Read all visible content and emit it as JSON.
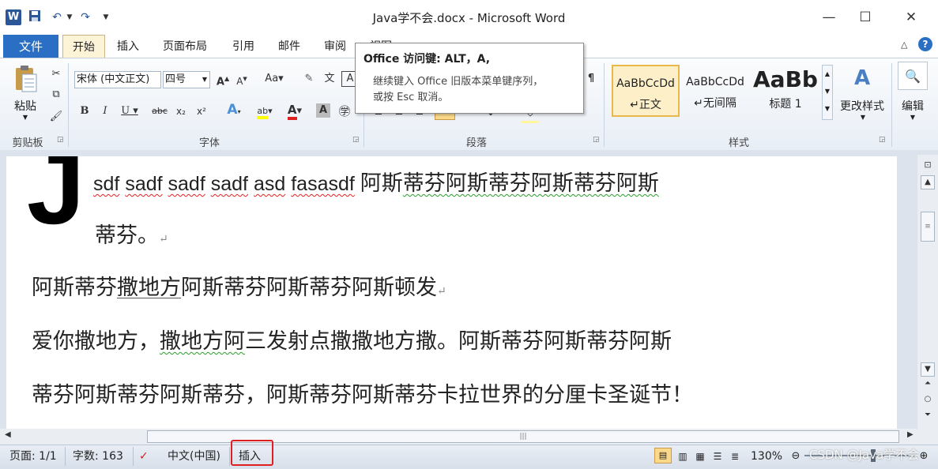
{
  "window": {
    "title": "Java学不会.docx - Microsoft Word",
    "app_icon": "W",
    "controls": {
      "minimize": "—",
      "maximize": "☐",
      "close": "✕"
    }
  },
  "tabs": [
    "文件",
    "开始",
    "插入",
    "页面布局",
    "引用",
    "邮件",
    "审阅",
    "视图"
  ],
  "ribbon": {
    "clipboard": {
      "paste_label": "粘贴",
      "group_label": "剪贴板"
    },
    "font": {
      "font_name": "宋体 (中文正文)",
      "font_size": "四号",
      "group_label": "字体"
    },
    "paragraph": {
      "group_label": "段落"
    },
    "styles": {
      "items": [
        {
          "sample": "AaBbCcDd",
          "name": "↵正文"
        },
        {
          "sample": "AaBbCcDd",
          "name": "↵无间隔"
        },
        {
          "sample": "AaBb",
          "name": "标题 1"
        }
      ],
      "change_styles_label": "更改样式",
      "group_label": "样式"
    },
    "editing": {
      "label": "编辑"
    }
  },
  "tooltip": {
    "title": "Office 访问键: ALT，A,",
    "line1": "继续键入 Office 旧版本菜单键序列，",
    "line2": "或按 Esc 取消。"
  },
  "document": {
    "dropcap": "J",
    "line1_words": [
      "sdf",
      "sadf",
      "sadf",
      "sadf",
      "asd",
      "fasasdf"
    ],
    "line1_cn_a": "阿斯",
    "line1_cn_b": "蒂芬阿斯蒂芬阿斯蒂芬阿斯",
    "line2": "蒂芬。",
    "p2_a": "阿斯蒂芬",
    "p2_b": "撒地方",
    "p2_c": "阿斯蒂芬阿斯蒂芬阿斯顿发",
    "p3_a": "爱你撒地方，",
    "p3_b": "撒地方阿",
    "p3_c": "三发射点撒撒地方撒。阿斯蒂芬阿斯蒂芬阿斯",
    "p4": "蒂芬阿斯蒂芬阿斯蒂芬，阿斯蒂芬阿斯蒂芬卡拉世界的分厘卡圣诞节！",
    "pilcrow": "↵"
  },
  "status": {
    "page": "页面: 1/1",
    "words": "字数: 163",
    "language": "中文(中国)",
    "mode": "插入",
    "zoom": "130%",
    "watermark": "CSDN @Java学不会"
  }
}
